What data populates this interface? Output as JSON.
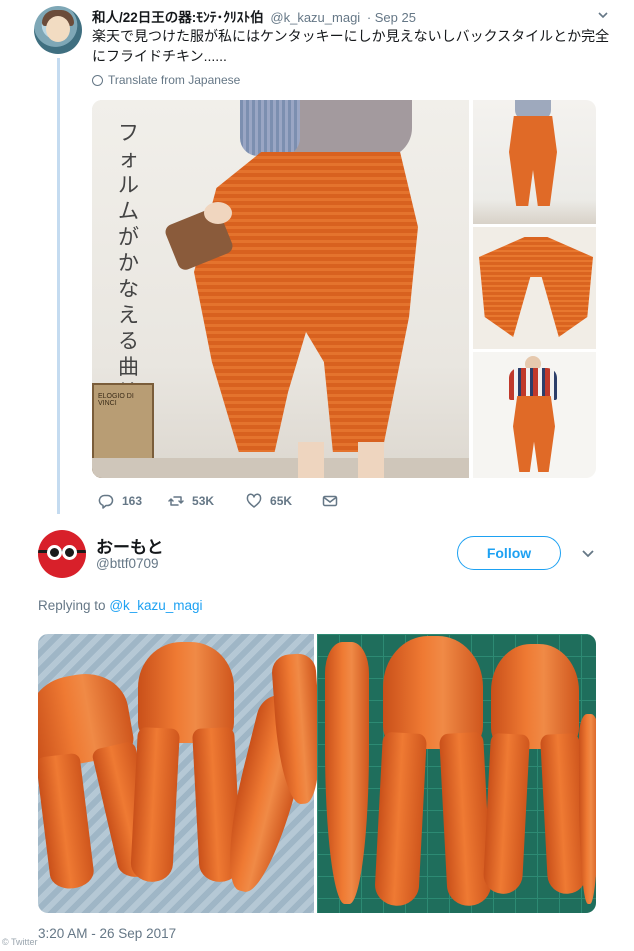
{
  "tweet1": {
    "display_name": "和人/22日王の器:ﾓﾝﾃ･ｸﾘｽﾄ伯",
    "handle": "@k_kazu_magi",
    "date": "· Sep 25",
    "text": "楽天で見つけた服が私にはケンタッキーにしか見えないしバックスタイルとか完全にフライドチキン......",
    "translate_label": "Translate from Japanese",
    "image_caption": "フォルムがかなえる曲線",
    "box_text": "ELOGIO DI VINCI",
    "actions": {
      "reply_count": "163",
      "retweet_count": "53K",
      "like_count": "65K"
    },
    "icons": [
      "globe-icon",
      "caret-down-icon",
      "reply-icon",
      "retweet-icon",
      "like-icon",
      "dm-icon"
    ]
  },
  "tweet2": {
    "display_name": "おーもと",
    "handle": "@bttf0709",
    "follow_label": "Follow",
    "replying_prefix": "Replying to",
    "replying_handle": "@k_kazu_magi",
    "timestamp": "3:20 AM - 26 Sep 2017"
  },
  "watermark": "© Twitter",
  "colors": {
    "link_blue": "#1da1f2",
    "muted_gray": "#657786",
    "thread_line": "#c4dbf0",
    "pants_orange": "#e06a27"
  }
}
